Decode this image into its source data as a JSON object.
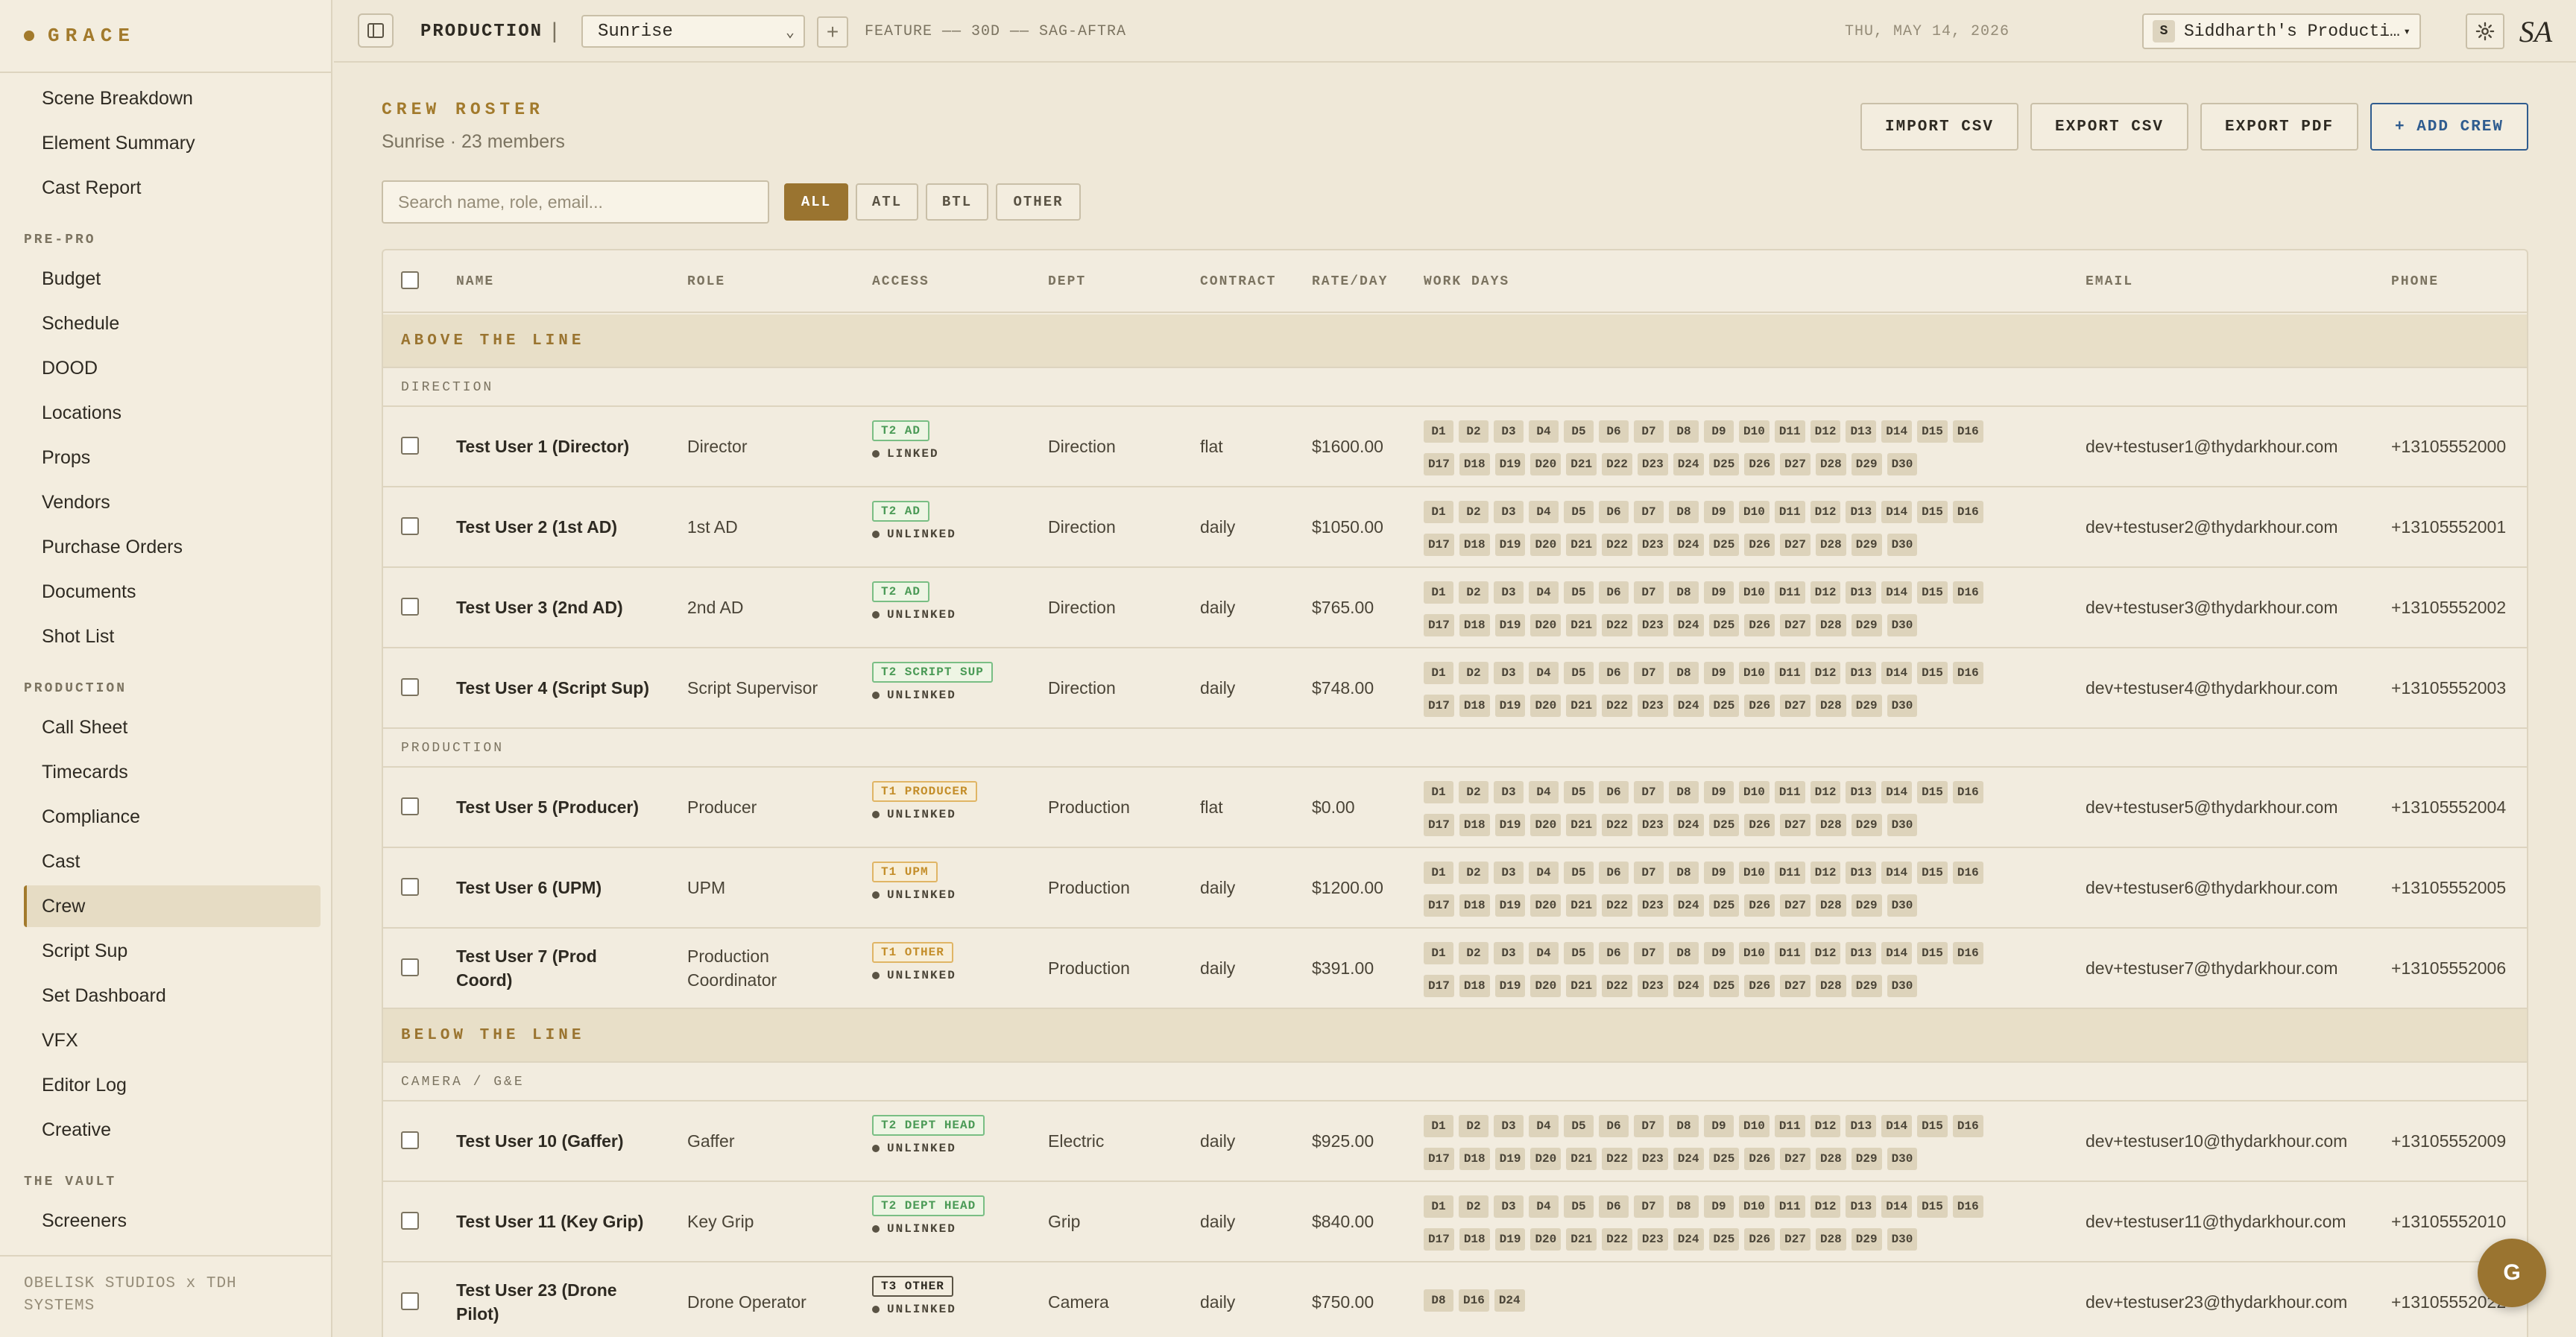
{
  "brand": {
    "name": "GRACE"
  },
  "sidebar": {
    "items_top": [
      "Scene Breakdown",
      "Element Summary",
      "Cast Report"
    ],
    "section_prepro": "PRE-PRO",
    "items_prepro": [
      "Budget",
      "Schedule",
      "DOOD",
      "Locations",
      "Props",
      "Vendors",
      "Purchase Orders",
      "Documents",
      "Shot List"
    ],
    "section_production": "PRODUCTION",
    "items_production": [
      "Call Sheet",
      "Timecards",
      "Compliance",
      "Cast",
      "Crew",
      "Script Sup",
      "Set Dashboard",
      "VFX",
      "Editor Log",
      "Creative"
    ],
    "active_item": "Crew",
    "section_vault": "THE VAULT",
    "items_vault": [
      "Screeners"
    ],
    "footer": "OBELISK STUDIOS x TDH SYSTEMS"
  },
  "topbar": {
    "section": "PRODUCTION",
    "divider": "|",
    "project": "Sunrise",
    "add_label": "+",
    "meta": "FEATURE —— 30D —— SAG-AFTRA",
    "date": "THU, MAY 14, 2026",
    "company_initial": "S",
    "company": "Siddharth's Producti…",
    "avatar": "SA"
  },
  "page": {
    "title": "CREW ROSTER",
    "subtitle": "Sunrise · 23 members",
    "buttons": {
      "import": "IMPORT CSV",
      "export_csv": "EXPORT CSV",
      "export_pdf": "EXPORT PDF",
      "add": "+ ADD CREW"
    },
    "search_placeholder": "Search name, role, email...",
    "filters": [
      "ALL",
      "ATL",
      "BTL",
      "OTHER"
    ]
  },
  "table": {
    "headers": {
      "name": "NAME",
      "role": "ROLE",
      "access": "ACCESS",
      "dept": "DEPT",
      "contract": "CONTRACT",
      "rate": "RATE/DAY",
      "days": "WORK DAYS",
      "email": "EMAIL",
      "phone": "PHONE"
    },
    "groups": {
      "atl": "ABOVE THE LINE",
      "btl": "BELOW THE LINE"
    },
    "depts": {
      "direction": "DIRECTION",
      "production": "PRODUCTION",
      "camera": "CAMERA / G&E"
    },
    "rows": [
      {
        "name": "Test User 1 (Director)",
        "role": "Director",
        "access": "T2 AD",
        "link": "LINKED",
        "dept": "Direction",
        "contract": "flat",
        "rate": "$1600.00",
        "email": "dev+testuser1@thydarkhour.com",
        "phone": "+13105552000"
      },
      {
        "name": "Test User 2 (1st AD)",
        "role": "1st AD",
        "access": "T2 AD",
        "link": "UNLINKED",
        "dept": "Direction",
        "contract": "daily",
        "rate": "$1050.00",
        "email": "dev+testuser2@thydarkhour.com",
        "phone": "+13105552001"
      },
      {
        "name": "Test User 3 (2nd AD)",
        "role": "2nd AD",
        "access": "T2 AD",
        "link": "UNLINKED",
        "dept": "Direction",
        "contract": "daily",
        "rate": "$765.00",
        "email": "dev+testuser3@thydarkhour.com",
        "phone": "+13105552002"
      },
      {
        "name": "Test User 4 (Script Sup)",
        "role": "Script Supervisor",
        "access": "T2 SCRIPT SUP",
        "link": "UNLINKED",
        "dept": "Direction",
        "contract": "daily",
        "rate": "$748.00",
        "email": "dev+testuser4@thydarkhour.com",
        "phone": "+13105552003"
      },
      {
        "name": "Test User 5 (Producer)",
        "role": "Producer",
        "access": "T1 PRODUCER",
        "link": "UNLINKED",
        "dept": "Production",
        "contract": "flat",
        "rate": "$0.00",
        "email": "dev+testuser5@thydarkhour.com",
        "phone": "+13105552004"
      },
      {
        "name": "Test User 6 (UPM)",
        "role": "UPM",
        "access": "T1 UPM",
        "link": "UNLINKED",
        "dept": "Production",
        "contract": "daily",
        "rate": "$1200.00",
        "email": "dev+testuser6@thydarkhour.com",
        "phone": "+13105552005"
      },
      {
        "name": "Test User 7 (Prod Coord)",
        "role": "Production Coordinator",
        "access": "T1 OTHER",
        "link": "UNLINKED",
        "dept": "Production",
        "contract": "daily",
        "rate": "$391.00",
        "email": "dev+testuser7@thydarkhour.com",
        "phone": "+13105552006"
      },
      {
        "name": "Test User 10 (Gaffer)",
        "role": "Gaffer",
        "access": "T2 DEPT HEAD",
        "link": "UNLINKED",
        "dept": "Electric",
        "contract": "daily",
        "rate": "$925.00",
        "email": "dev+testuser10@thydarkhour.com",
        "phone": "+13105552009"
      },
      {
        "name": "Test User 11 (Key Grip)",
        "role": "Key Grip",
        "access": "T2 DEPT HEAD",
        "link": "UNLINKED",
        "dept": "Grip",
        "contract": "daily",
        "rate": "$840.00",
        "email": "dev+testuser11@thydarkhour.com",
        "phone": "+13105552010"
      },
      {
        "name": "Test User 23 (Drone Pilot)",
        "role": "Drone Operator",
        "access": "T3 OTHER",
        "link": "UNLINKED",
        "dept": "Camera",
        "contract": "daily",
        "rate": "$750.00",
        "email": "dev+testuser23@thydarkhour.com",
        "phone": "+13105552022"
      }
    ],
    "all_days": [
      "D1",
      "D2",
      "D3",
      "D4",
      "D5",
      "D6",
      "D7",
      "D8",
      "D9",
      "D10",
      "D11",
      "D12",
      "D13",
      "D14",
      "D15",
      "D16",
      "D17",
      "D18",
      "D19",
      "D20",
      "D21",
      "D22",
      "D23",
      "D24",
      "D25",
      "D26",
      "D27",
      "D28",
      "D29",
      "D30"
    ],
    "drone_days": [
      "D8",
      "D16",
      "D24"
    ]
  },
  "fab": "G"
}
